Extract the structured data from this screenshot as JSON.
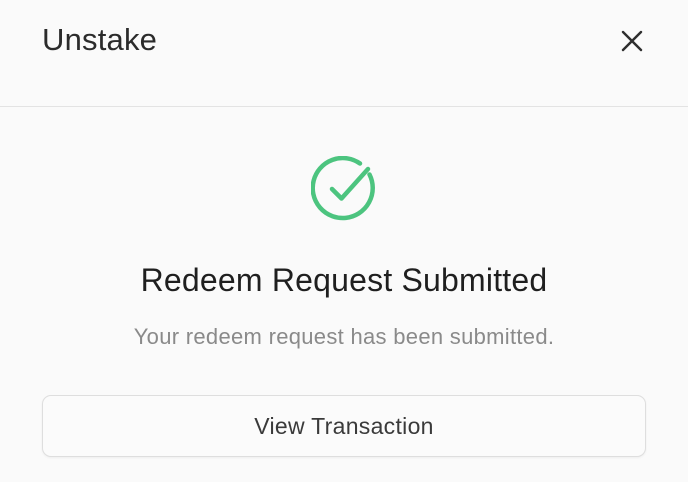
{
  "modal": {
    "title": "Unstake",
    "close_icon": "close-icon"
  },
  "result": {
    "icon": "check-circle-icon",
    "icon_color": "#4cc47f",
    "title": "Redeem Request Submitted",
    "message": "Your redeem request has been submitted."
  },
  "actions": {
    "view_transaction_label": "View Transaction"
  }
}
